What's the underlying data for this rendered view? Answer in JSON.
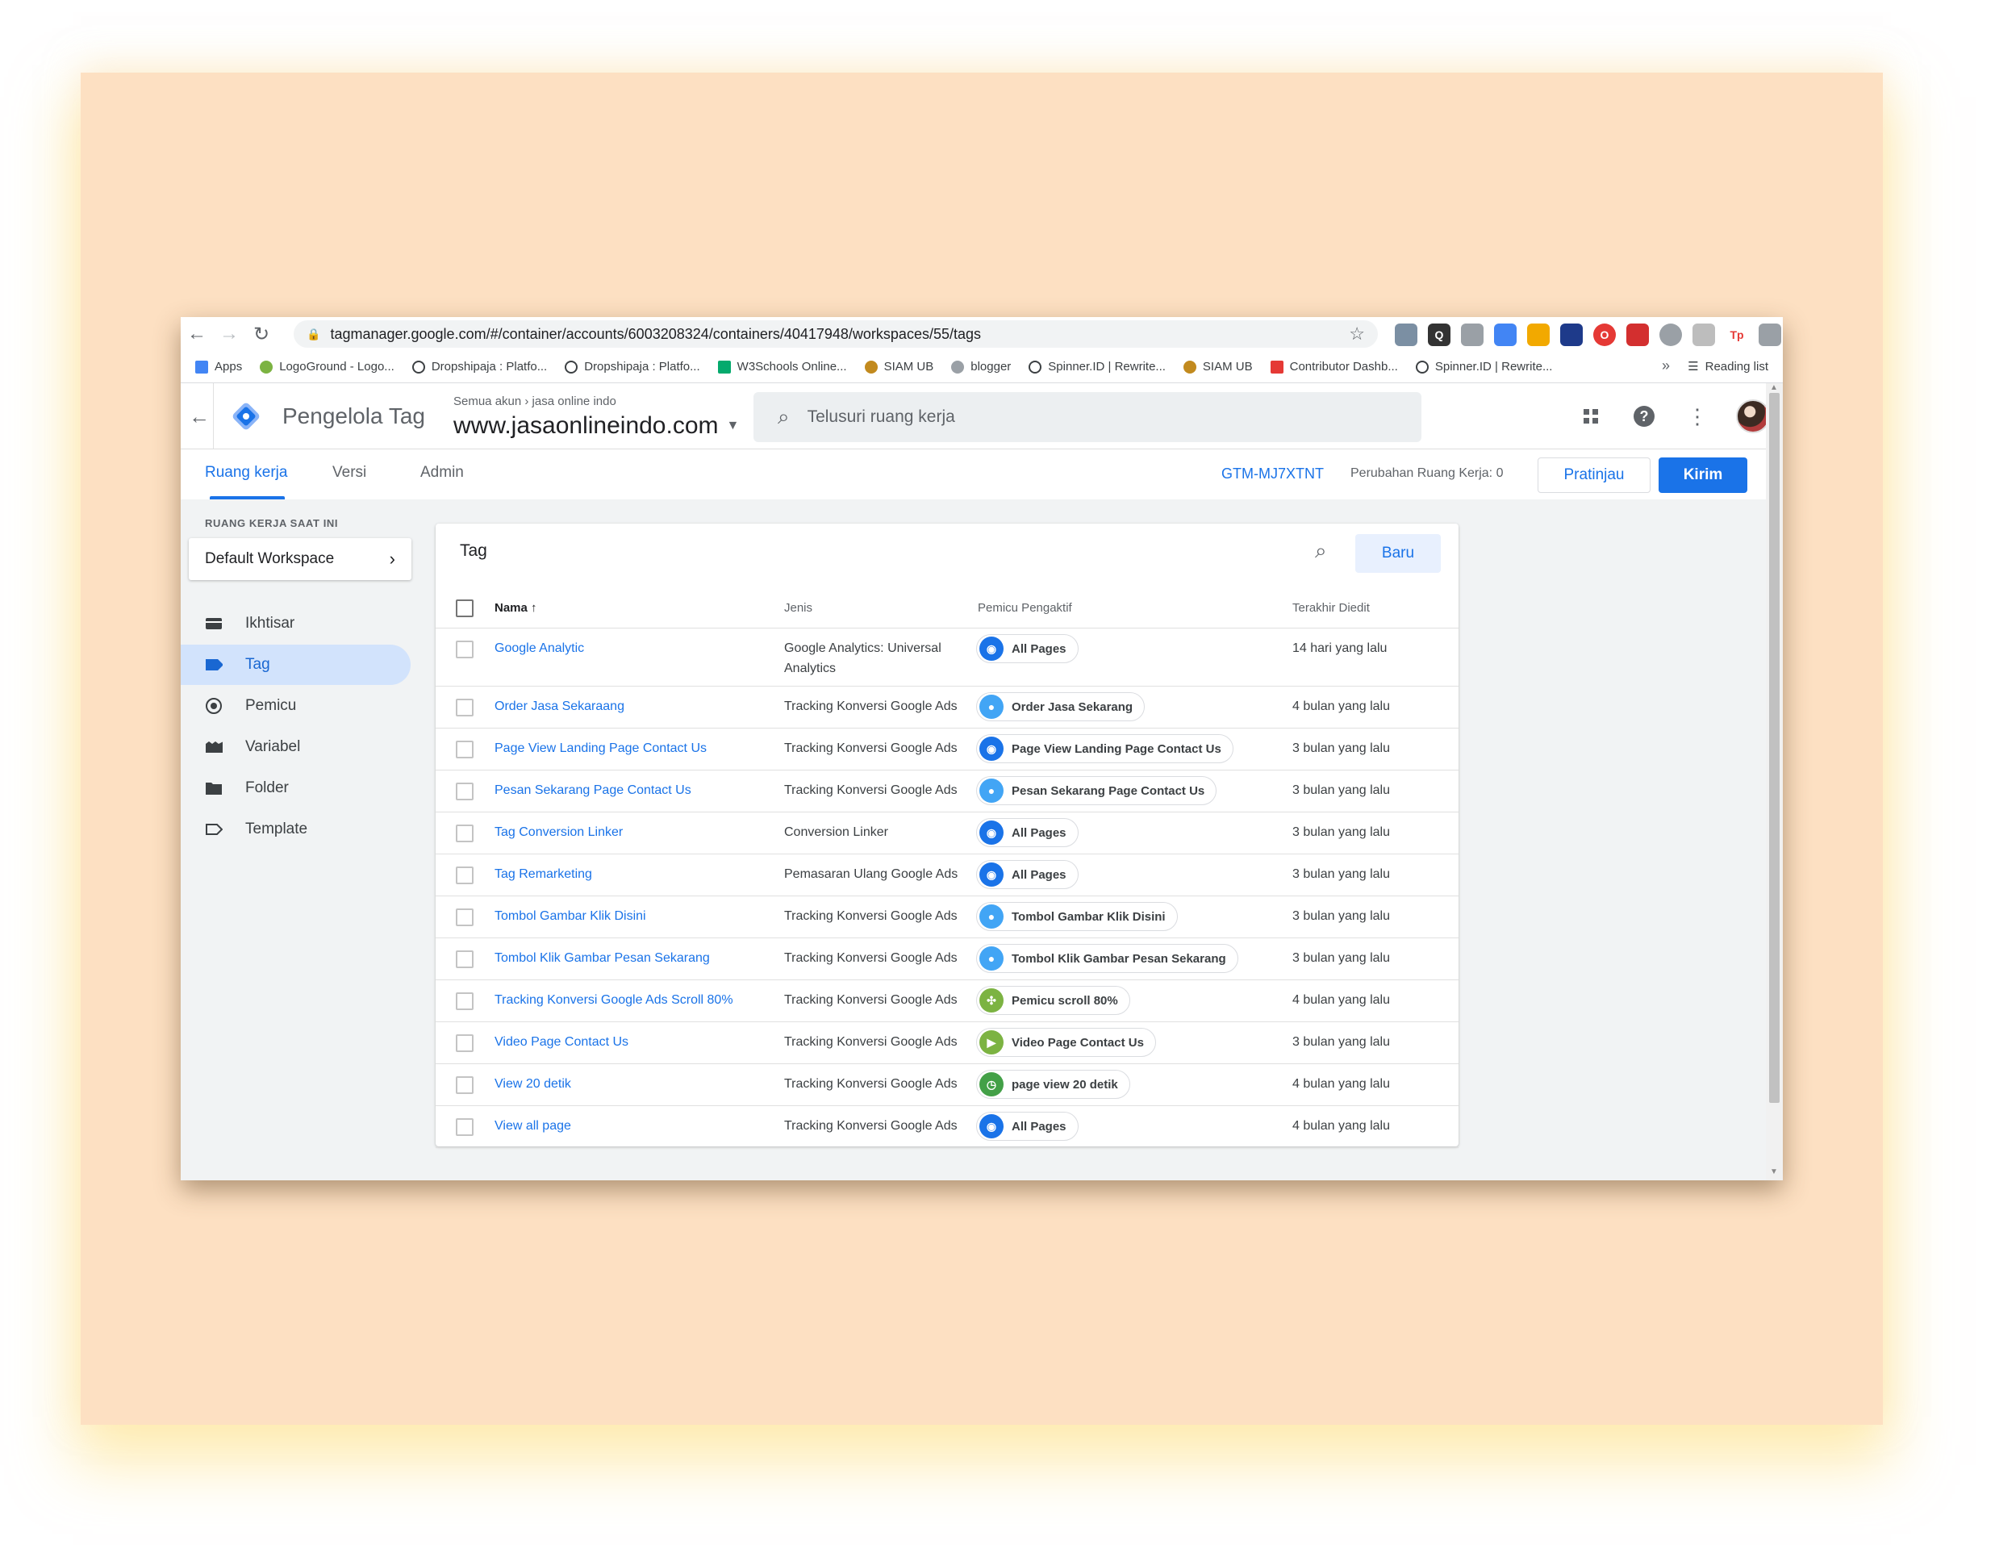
{
  "browser": {
    "url": "tagmanager.google.com/#/container/accounts/6003208324/containers/40417948/workspaces/55/tags",
    "bookmarks": [
      {
        "label": "Apps",
        "color": "#4285f4"
      },
      {
        "label": "LogoGround - Logo...",
        "color": "#7cb342"
      },
      {
        "label": "Dropshipaja : Platfo...",
        "color": "#3c4043"
      },
      {
        "label": "Dropshipaja : Platfo...",
        "color": "#3c4043"
      },
      {
        "label": "W3Schools Online...",
        "color": "#04aa6d"
      },
      {
        "label": "SIAM UB",
        "color": "#c28a1e"
      },
      {
        "label": "blogger",
        "color": "#5f6368"
      },
      {
        "label": "Spinner.ID | Rewrite...",
        "color": "#3c4043"
      },
      {
        "label": "SIAM UB",
        "color": "#c28a1e"
      },
      {
        "label": "Contributor Dashb...",
        "color": "#e53935"
      },
      {
        "label": "Spinner.ID | Rewrite...",
        "color": "#3c4043"
      }
    ],
    "more_bookmarks": "»",
    "reading_list": "Reading list"
  },
  "header": {
    "app_name": "Pengelola Tag",
    "account_path": "Semua akun › jasa online indo",
    "container_name": "www.jasaonlineindo.com",
    "search_placeholder": "Telusuri ruang kerja"
  },
  "tabs": {
    "workspace": "Ruang kerja",
    "versions": "Versi",
    "admin": "Admin",
    "container_id": "GTM-MJ7XTNT",
    "changes": "Perubahan Ruang Kerja: 0",
    "preview": "Pratinjau",
    "submit": "Kirim"
  },
  "sidebar": {
    "workspace_label": "RUANG KERJA SAAT INI",
    "workspace_name": "Default Workspace",
    "items": [
      {
        "label": "Ikhtisar",
        "icon": "overview-icon"
      },
      {
        "label": "Tag",
        "icon": "tag-icon",
        "active": true
      },
      {
        "label": "Pemicu",
        "icon": "trigger-icon"
      },
      {
        "label": "Variabel",
        "icon": "variable-icon"
      },
      {
        "label": "Folder",
        "icon": "folder-icon"
      },
      {
        "label": "Template",
        "icon": "template-icon"
      }
    ]
  },
  "table": {
    "title": "Tag",
    "new_button": "Baru",
    "columns": {
      "name": "Nama",
      "type": "Jenis",
      "trigger": "Pemicu Pengaktif",
      "edited": "Terakhir Diedit"
    },
    "sort_arrow": "↑",
    "rows": [
      {
        "name": "Google Analytic",
        "type": "Google Analytics: Universal Analytics",
        "trigger": "All Pages",
        "trigger_icon": "pageview",
        "edited": "14 hari yang lalu"
      },
      {
        "name": "Order Jasa Sekaraang",
        "type": "Tracking Konversi Google Ads",
        "trigger": "Order Jasa Sekarang",
        "trigger_icon": "click",
        "edited": "4 bulan yang lalu"
      },
      {
        "name": "Page View Landing Page Contact Us",
        "type": "Tracking Konversi Google Ads",
        "trigger": "Page View Landing Page Contact Us",
        "trigger_icon": "pageview",
        "edited": "3 bulan yang lalu"
      },
      {
        "name": "Pesan Sekarang Page Contact Us",
        "type": "Tracking Konversi Google Ads",
        "trigger": "Pesan Sekarang Page Contact Us",
        "trigger_icon": "click",
        "edited": "3 bulan yang lalu"
      },
      {
        "name": "Tag Conversion Linker",
        "type": "Conversion Linker",
        "trigger": "All Pages",
        "trigger_icon": "pageview",
        "edited": "3 bulan yang lalu"
      },
      {
        "name": "Tag Remarketing",
        "type": "Pemasaran Ulang Google Ads",
        "trigger": "All Pages",
        "trigger_icon": "pageview",
        "edited": "3 bulan yang lalu"
      },
      {
        "name": "Tombol Gambar Klik Disini",
        "type": "Tracking Konversi Google Ads",
        "trigger": "Tombol Gambar Klik Disini",
        "trigger_icon": "click",
        "edited": "3 bulan yang lalu"
      },
      {
        "name": "Tombol Klik Gambar Pesan Sekarang",
        "type": "Tracking Konversi Google Ads",
        "trigger": "Tombol Klik Gambar Pesan Sekarang",
        "trigger_icon": "click",
        "edited": "3 bulan yang lalu"
      },
      {
        "name": "Tracking Konversi Google Ads Scroll 80%",
        "type": "Tracking Konversi Google Ads",
        "trigger": "Pemicu scroll 80%",
        "trigger_icon": "scroll",
        "edited": "4 bulan yang lalu"
      },
      {
        "name": "Video Page Contact Us",
        "type": "Tracking Konversi Google Ads",
        "trigger": "Video Page Contact Us",
        "trigger_icon": "video",
        "edited": "3 bulan yang lalu"
      },
      {
        "name": "View 20 detik",
        "type": "Tracking Konversi Google Ads",
        "trigger": "page view 20 detik",
        "trigger_icon": "timer",
        "edited": "4 bulan yang lalu"
      },
      {
        "name": "View all page",
        "type": "Tracking Konversi Google Ads",
        "trigger": "All Pages",
        "trigger_icon": "pageview",
        "edited": "4 bulan yang lalu"
      }
    ]
  },
  "colors": {
    "accent": "#1a73e8",
    "active_nav_bg": "#d2e3fc",
    "background": "#fde0c2"
  }
}
